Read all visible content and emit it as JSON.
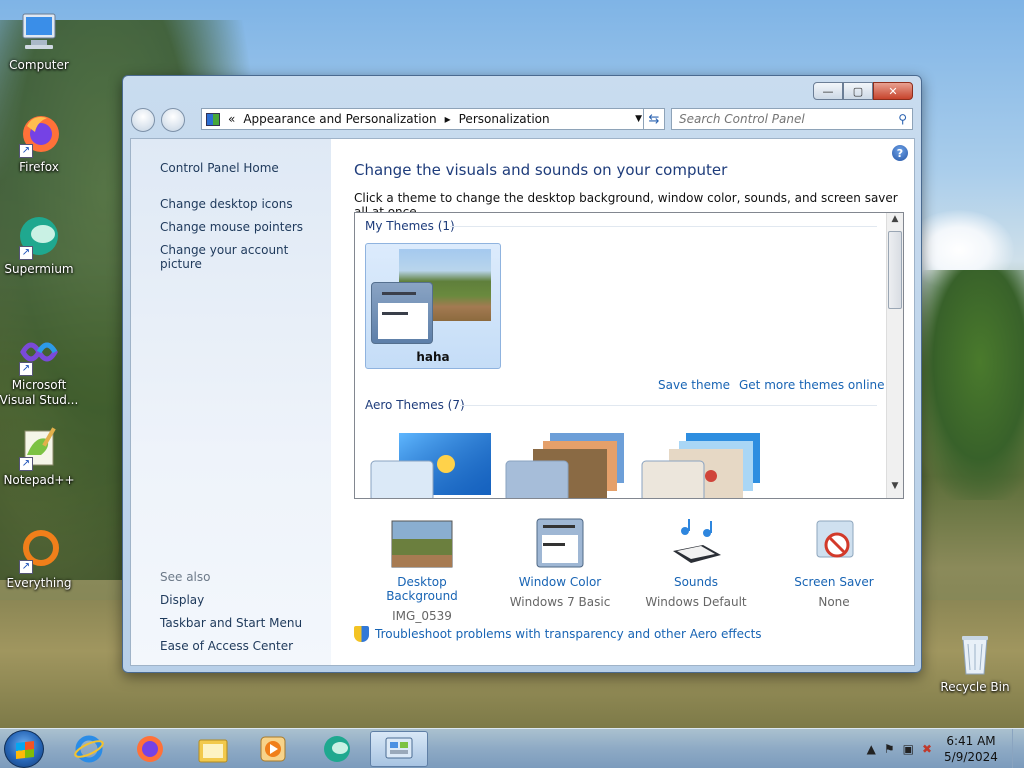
{
  "desktop": {
    "icons": [
      {
        "label": "Computer",
        "icon": "computer-icon"
      },
      {
        "label": "Firefox",
        "icon": "firefox-icon"
      },
      {
        "label": "Supermium",
        "icon": "supermium-icon"
      },
      {
        "label": "Microsoft Visual Stud...",
        "icon": "visual-studio-icon"
      },
      {
        "label": "Notepad++",
        "icon": "notepadpp-icon"
      },
      {
        "label": "Everything",
        "icon": "everything-icon"
      },
      {
        "label": "Recycle Bin",
        "icon": "recycle-bin-icon"
      }
    ]
  },
  "window": {
    "address": {
      "back_chevrons": "«",
      "crumb1": "Appearance and Personalization",
      "separator": "▸",
      "crumb2": "Personalization"
    },
    "search_placeholder": "Search Control Panel",
    "caption": {
      "min": "—",
      "max": "▢",
      "close": "✕"
    }
  },
  "left_pane": {
    "home": "Control Panel Home",
    "links": [
      "Change desktop icons",
      "Change mouse pointers",
      "Change your account picture"
    ],
    "see_also_title": "See also",
    "see_also": [
      "Display",
      "Taskbar and Start Menu",
      "Ease of Access Center"
    ]
  },
  "main": {
    "help": "?",
    "title": "Change the visuals and sounds on your computer",
    "subtitle": "Click a theme to change the desktop background, window color, sounds, and screen saver all at once.",
    "my_themes_header": "My Themes (1)",
    "my_theme_name": "haha",
    "save_theme": "Save theme",
    "more_themes": "Get more themes online",
    "aero_header": "Aero Themes (7)",
    "settings": [
      {
        "label": "Desktop Background",
        "value": "IMG_0539",
        "icon": "desktop-background-icon"
      },
      {
        "label": "Window Color",
        "value": "Windows 7 Basic",
        "icon": "window-color-icon"
      },
      {
        "label": "Sounds",
        "value": "Windows Default",
        "icon": "sounds-icon"
      },
      {
        "label": "Screen Saver",
        "value": "None",
        "icon": "screen-saver-icon"
      }
    ],
    "troubleshoot": "Troubleshoot problems with transparency and other Aero effects"
  },
  "taskbar": {
    "apps": [
      "internet-explorer-icon",
      "firefox-icon",
      "file-explorer-icon",
      "media-player-icon",
      "supermium-icon",
      "control-panel-icon"
    ],
    "time": "6:41 AM",
    "date": "5/9/2024"
  }
}
